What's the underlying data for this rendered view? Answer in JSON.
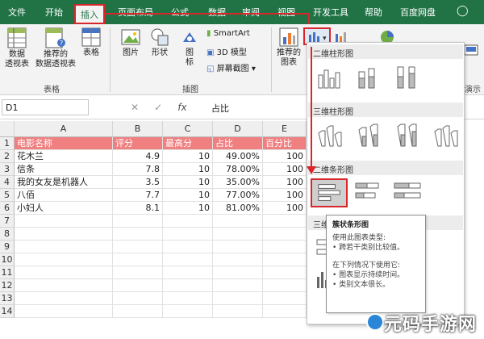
{
  "tabs": [
    "文件",
    "开始",
    "插入",
    "页面布局",
    "公式",
    "数据",
    "审阅",
    "视图",
    "开发工具",
    "帮助",
    "百度网盘"
  ],
  "active_tab": "插入",
  "ribbon": {
    "pivot_label": "数据\n透视表",
    "rec_pivot_label": "推荐的\n数据透视表",
    "table_label": "表格",
    "group_tables": "表格",
    "picture_label": "图片",
    "shape_label": "形状",
    "icon_label": "图\n标",
    "smartart_label": "SmartArt",
    "model3d_label": "3D 模型",
    "screenshot_label": "屏幕截图",
    "group_illustrations": "插图",
    "rec_chart_label": "推荐的\n图表",
    "group_demo": "演示"
  },
  "formula_bar": {
    "name_box": "D1",
    "formula": "占比",
    "fx": "fx"
  },
  "columns": [
    "A",
    "B",
    "C",
    "D",
    "E"
  ],
  "rows": [
    "1",
    "2",
    "3",
    "4",
    "5",
    "6",
    "7",
    "8",
    "9",
    "10",
    "11",
    "12",
    "13",
    "14"
  ],
  "table": {
    "header": [
      "电影名称",
      "评分",
      "最高分",
      "占比",
      "百分比"
    ],
    "data": [
      [
        "花木兰",
        "4.9",
        "10",
        "49.00%",
        "100"
      ],
      [
        "信条",
        "7.8",
        "10",
        "78.00%",
        "100"
      ],
      [
        "我的女友是机器人",
        "3.5",
        "10",
        "35.00%",
        "100"
      ],
      [
        "八佰",
        "7.7",
        "10",
        "77.00%",
        "100"
      ],
      [
        "小妇人",
        "8.1",
        "10",
        "81.00%",
        "100"
      ]
    ]
  },
  "dropdown": {
    "sections": [
      "二维柱形图",
      "三维柱形图",
      "二维条形图",
      "三维"
    ]
  },
  "tooltip": {
    "title": "簇状条形图",
    "lines": [
      "使用此图表类型:",
      "• 跨若干类别比较值。",
      "",
      "在下列情况下使用它:",
      "• 图表显示持续时间。",
      "• 类别文本很长。"
    ]
  },
  "watermark": "元码手游网",
  "colors": {
    "ribbon_green": "#217346",
    "header_fill": "#f07f80",
    "highlight_red": "#d9262a",
    "chart_blue": "#4472c4"
  }
}
